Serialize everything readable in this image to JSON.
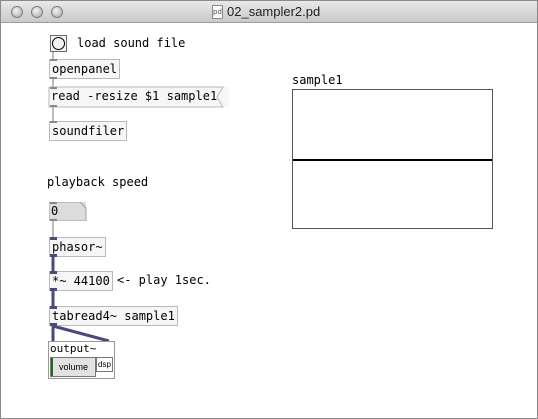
{
  "window": {
    "title": "02_sampler2.pd",
    "doc_icon_label": "pd"
  },
  "patch": {
    "bang_label": "load sound file",
    "openpanel": "openpanel",
    "read_msg": "read -resize $1 sample1",
    "soundfiler": "soundfiler",
    "playback_label": "playback speed",
    "number_value": "0",
    "phasor": "phasor~",
    "multiply": "*~ 44100",
    "multiply_comment": "<- play 1sec.",
    "tabread": "tabread4~ sample1",
    "output_label": "output~",
    "volume_label": "volume",
    "dsp_label": "dsp",
    "volume_level": 0.04
  },
  "array": {
    "name": "sample1"
  },
  "colors": {
    "signal_wire": "#4a4a7a",
    "control_wire": "#777777",
    "volume_fill": "#1f6b1f"
  }
}
